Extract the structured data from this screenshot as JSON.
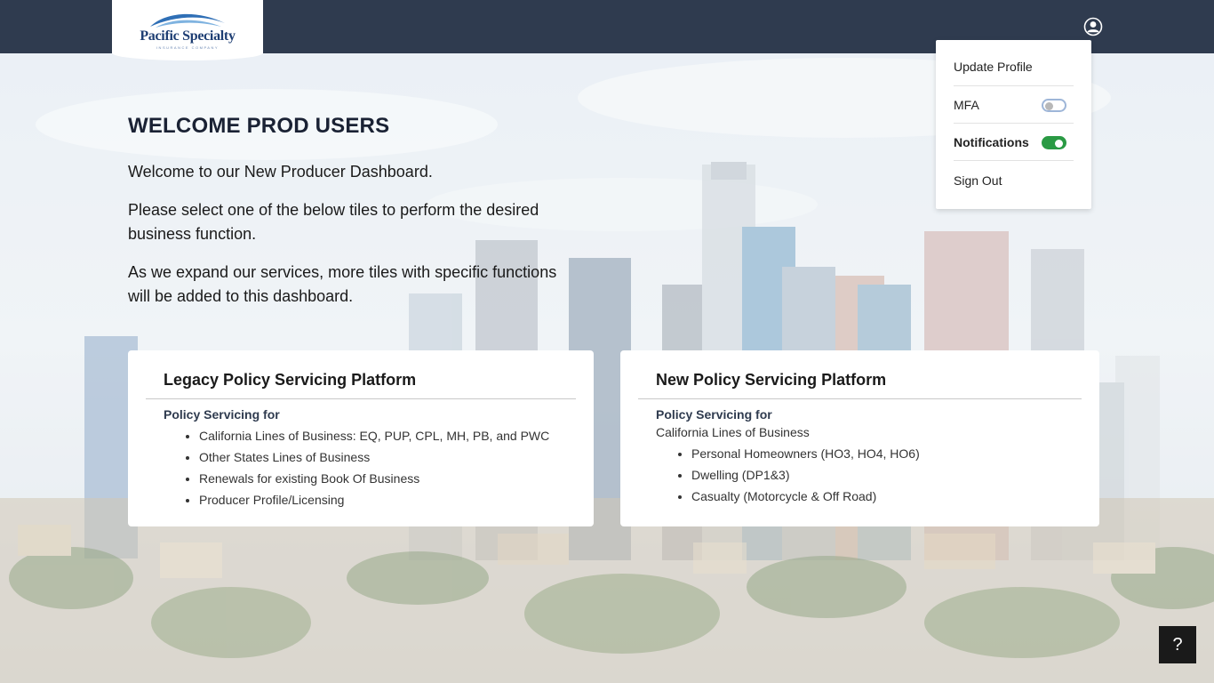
{
  "brand": {
    "logo_text": "Pacific Specialty",
    "logo_subtext": "INSURANCE COMPANY"
  },
  "header": {
    "user_icon": "user-circle-icon"
  },
  "user_menu": {
    "update_profile": "Update Profile",
    "mfa_label": "MFA",
    "mfa_enabled": false,
    "notifications_label": "Notifications",
    "notifications_enabled": true,
    "sign_out": "Sign Out"
  },
  "welcome": {
    "title": "WELCOME PROD USERS",
    "intro": "Welcome to our New Producer Dashboard.",
    "instruction": "Please select one of the below tiles to perform the desired business function.",
    "expansion_note": "As we expand our services, more tiles with specific functions will be added to this dashboard."
  },
  "tiles": [
    {
      "title": "Legacy Policy Servicing Platform",
      "subheading": "Policy Servicing for",
      "items": [
        "California Lines of Business: EQ, PUP, CPL, MH, PB, and PWC",
        "Other States Lines of Business",
        "Renewals for existing Book Of Business",
        "Producer Profile/Licensing"
      ]
    },
    {
      "title": "New Policy Servicing Platform",
      "subheading": "Policy Servicing for",
      "subline": "California Lines of Business",
      "items": [
        "Personal Homeowners (HO3, HO4, HO6)",
        "Dwelling (DP1&3)",
        "Casualty (Motorcycle & Off Road)"
      ]
    }
  ],
  "help": {
    "label": "?"
  },
  "colors": {
    "topbar": "#2f3b4f",
    "toggle_on": "#2a9a44",
    "help_bg": "#1a1a1a"
  }
}
